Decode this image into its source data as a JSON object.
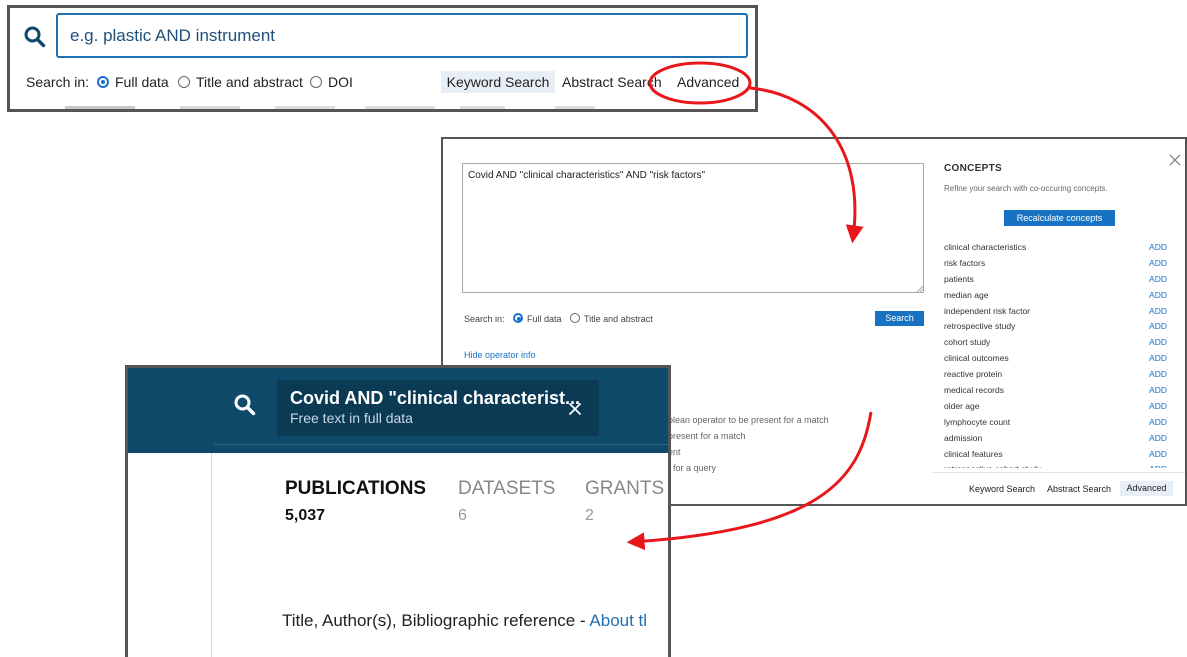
{
  "search_bar": {
    "placeholder": "e.g. plastic AND instrument",
    "search_in_label": "Search in:",
    "options": [
      "Full data",
      "Title and abstract",
      "DOI"
    ],
    "selected": "Full data",
    "modes": [
      "Keyword Search",
      "Abstract Search",
      "Advanced"
    ],
    "active_mode": "Keyword Search",
    "highlighted": "Advanced"
  },
  "advanced": {
    "query": "Covid AND \"clinical characteristics\" AND \"risk factors\"",
    "search_in_label": "Search in:",
    "options": [
      "Full data",
      "Title and abstract"
    ],
    "selected": "Full data",
    "search_button": "Search",
    "hide_operator_info": "Hide operator info",
    "operator_lines": [
      "olean operator to be present for a match",
      "present for a match",
      "ent",
      "t for a query"
    ],
    "concepts_title": "CONCEPTS",
    "concepts_subtitle": "Refine your search with co-occuring concepts.",
    "recalculate_button": "Recalculate concepts",
    "add_label": "ADD",
    "concepts": [
      "clinical characteristics",
      "risk factors",
      "patients",
      "median age",
      "independent risk factor",
      "retrospective study",
      "cohort study",
      "clinical outcomes",
      "reactive protein",
      "medical records",
      "older age",
      "lymphocyte count",
      "admission",
      "clinical features",
      "retrospective cohort study"
    ],
    "footer_modes": [
      "Keyword Search",
      "Abstract Search",
      "Advanced"
    ],
    "active_footer_mode": "Advanced"
  },
  "results": {
    "query_title": "Covid AND \"clinical characterist...",
    "query_subtitle": "Free text in full data",
    "tabs": [
      {
        "label": "PUBLICATIONS",
        "count": "5,037"
      },
      {
        "label": "DATASETS",
        "count": "6"
      },
      {
        "label": "GRANTS",
        "count": "2"
      }
    ],
    "title_row": "Title, Author(s), Bibliographic reference - ",
    "about_link": "About tl"
  },
  "colors": {
    "accent": "#1773c2",
    "header_bg": "#0f4a6a",
    "chip_bg": "#0b3a55",
    "annotation": "#e8171b"
  }
}
